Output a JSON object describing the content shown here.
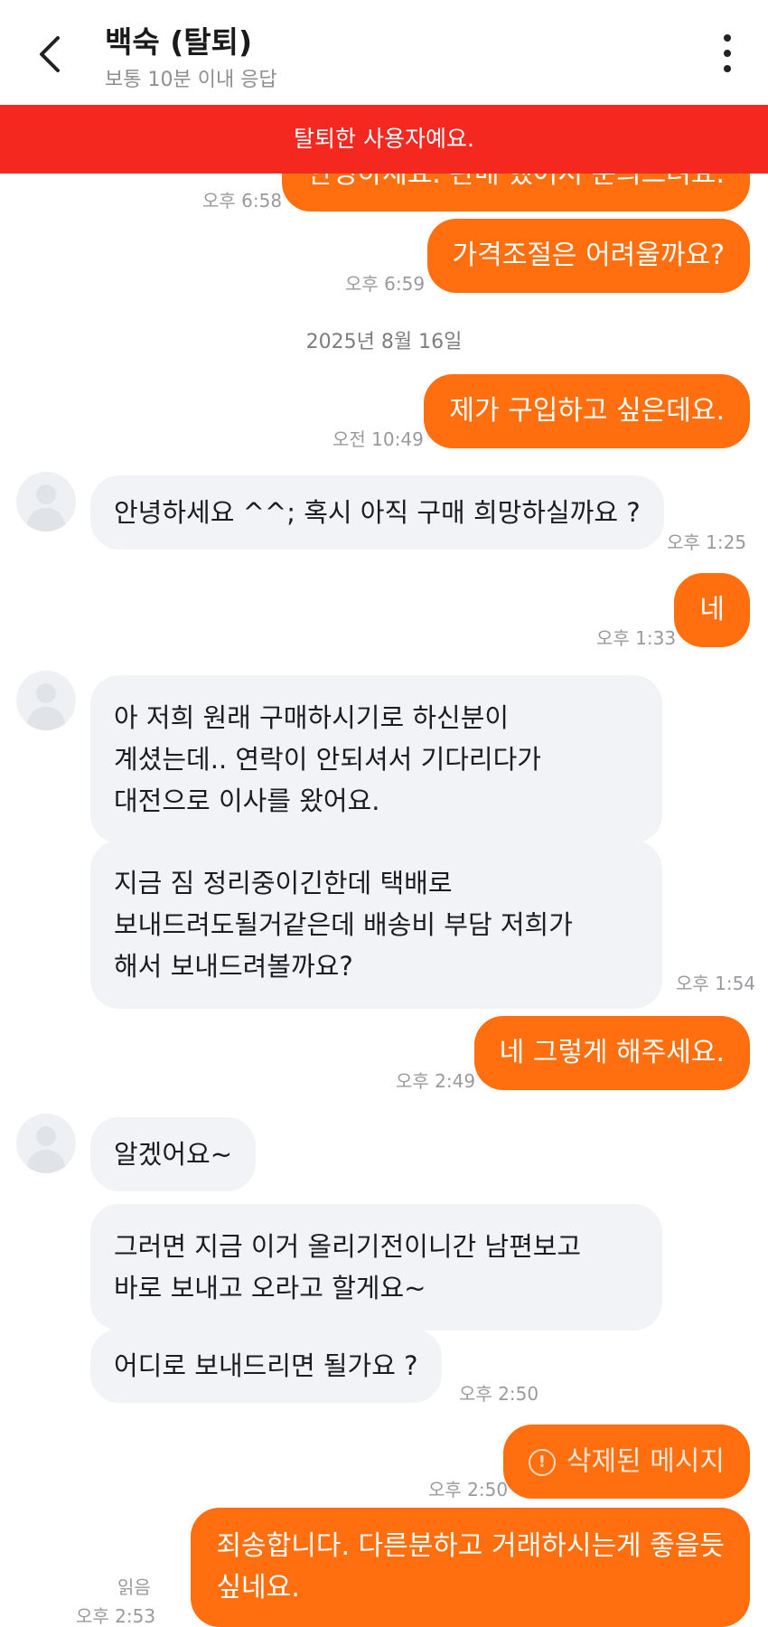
{
  "header": {
    "title": "백숙 (탈퇴)",
    "subtitle": "보통 10분 이내 응답"
  },
  "banner": {
    "text": "탈퇴한 사용자예요."
  },
  "messages": {
    "m0": {
      "text": "안녕하세요. 판매 했어서 문의드려요.",
      "time": "오후 6:58"
    },
    "m1": {
      "text": "가격조절은 어려울까요?",
      "time": "오후 6:59"
    },
    "date1": "2025년 8월 16일",
    "m2": {
      "text": "제가 구입하고 싶은데요.",
      "time": "오전 10:49"
    },
    "m3": {
      "text": "안녕하세요 ^^; 혹시 아직 구매 희망하실까요 ?",
      "time": "오후 1:25"
    },
    "m4": {
      "text": "네",
      "time": "오후 1:33"
    },
    "m5": {
      "lines": [
        "아 저희 원래 구매하시기로 하신분이",
        "계셨는데.. 연락이 안되셔서 기다리다가",
        "대전으로 이사를 왔어요."
      ]
    },
    "m6": {
      "lines": [
        "지금 짐 정리중이긴한데 택배로",
        "보내드려도될거같은데 배송비 부담 저희가",
        "해서 보내드려볼까요?"
      ],
      "time": "오후 1:54"
    },
    "m7": {
      "text": "네 그렇게 해주세요.",
      "time": "오후 2:49"
    },
    "m8": {
      "text": "알겠어요~"
    },
    "m9": {
      "lines": [
        "그러면 지금 이거 올리기전이니간 남편보고",
        "바로 보내고 오라고 할게요~"
      ]
    },
    "m10": {
      "text": "어디로 보내드리면 될가요 ?",
      "time": "오후 2:50"
    },
    "m11": {
      "text": "삭제된 메시지",
      "icon": "exclamation-circle-icon",
      "time": "오후 2:50"
    },
    "m12": {
      "lines": [
        "죄송합니다. 다른분하고 거래하시는게 좋을듯",
        "싶네요."
      ],
      "read": "읽음",
      "time": "오후 2:53"
    }
  },
  "colors": {
    "accent": "#ff6f0f",
    "banner": "#f4281f",
    "incoming": "#f2f3f6"
  }
}
